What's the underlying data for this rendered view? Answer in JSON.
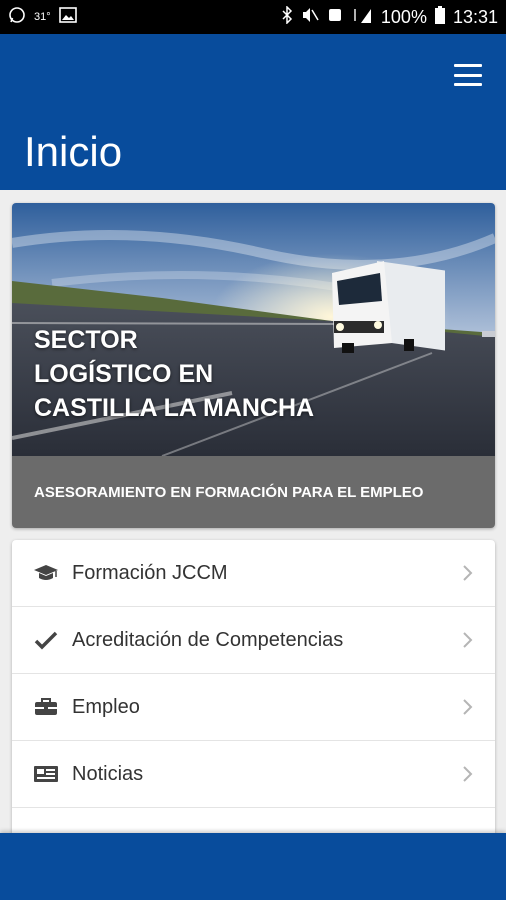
{
  "status_bar": {
    "temperature": "31°",
    "battery": "100%",
    "time": "13:31"
  },
  "header": {
    "title": "Inicio"
  },
  "banner": {
    "heading_lines": [
      "SECTOR",
      "LOGÍSTICO EN",
      "CASTILLA LA MANCHA"
    ],
    "subtitle": "ASESORAMIENTO EN FORMACIÓN PARA EL EMPLEO"
  },
  "menu": {
    "items": [
      {
        "label": "Formación JCCM",
        "icon": "graduation-cap-icon"
      },
      {
        "label": "Acreditación de Competencias",
        "icon": "checkmark-icon"
      },
      {
        "label": "Empleo",
        "icon": "toolbox-icon"
      },
      {
        "label": "Noticias",
        "icon": "newspaper-icon"
      }
    ]
  },
  "colors": {
    "primary": "#084c9c",
    "banner_footer": "#6b6b6b",
    "text": "#333333"
  }
}
